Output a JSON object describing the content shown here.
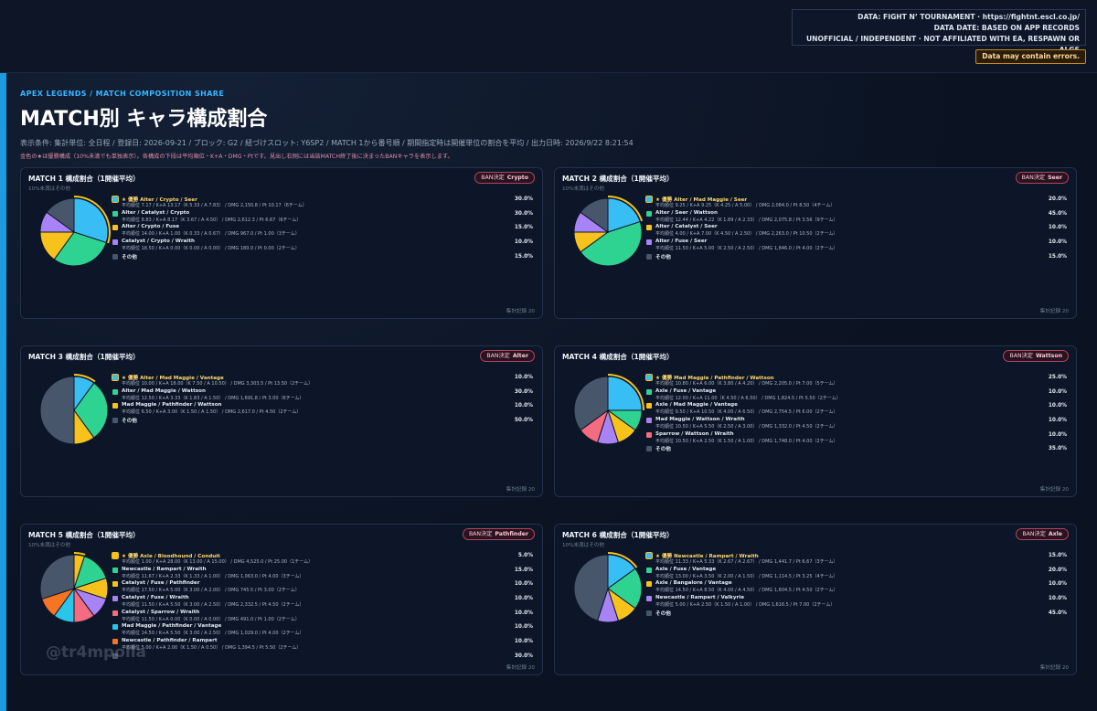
{
  "source": {
    "line1": "DATA: FIGHT N’ TOURNAMENT · https://fightnt.escl.co.jp/",
    "line2": "DATA DATE: BASED ON APP RECORDS",
    "line3": "UNOFFICIAL / INDEPENDENT · NOT AFFILIATED WITH EA, RESPAWN OR ALGS",
    "warning": "Data may contain errors."
  },
  "header": {
    "eyebrow": "APEX LEGENDS / MATCH COMPOSITION SHARE",
    "title": "MATCH別 キャラ構成割合",
    "conditions": "表示条件: 集計単位: 全日程 / 登録日: 2026-09-21 / ブロック: G2 / 紐づけスロット: Y6SP2 / MATCH 1から番号順 / 期間指定時は開催単位の割合を平均 / 出力日時: 2026/9/22 8:21:54",
    "note": "金色の★は優勝構成（10%未満でも単独表示）。各構成の下段は平均順位・K+A・DMG・Ptです。見出し右側には当該MATCH終了後に決まったBANキャラを表示します。"
  },
  "colors": {
    "blue": "#39bdf5",
    "green": "#2fd391",
    "yellow": "#f7c21b",
    "purple": "#a883f6",
    "red": "#f56b7f",
    "cyan": "#29c5ea",
    "orange": "#f77422",
    "gray": "#48566b",
    "best_ring": "#f7c21b"
  },
  "watermark": "@tr4mpolla",
  "ban_label": "BAN決定",
  "chart_data": [
    {
      "type": "pie",
      "title": "MATCH 1 構成割合（1開催平均）",
      "subtitle": "10%未満はその他",
      "ban": "Crypto",
      "footer": "集計記録 20",
      "slices": [
        {
          "name": "★ 優勝  Alter / Crypto / Seer",
          "stats": "平均順位 7.17 / K+A 13.17（K 5.33 / A 7.83） / DMG 2,150.8 / Pt 10.17（6チーム）",
          "value": 30,
          "label": "30.0%",
          "color": "blue",
          "best": true
        },
        {
          "name": "Alter / Catalyst / Crypto",
          "stats": "平均順位 8.83 / K+A 8.17（K 3.67 / A 4.50） / DMG 2,612.3 / Pt 6.67（6チーム）",
          "value": 30,
          "label": "30.0%",
          "color": "green"
        },
        {
          "name": "Alter / Crypto / Fuse",
          "stats": "平均順位 14.00 / K+A 1.00（K 0.33 / A 0.67） / DMG 967.0 / Pt 1.00（3チーム）",
          "value": 15,
          "label": "15.0%",
          "color": "yellow"
        },
        {
          "name": "Catalyst / Crypto / Wraith",
          "stats": "平均順位 18.50 / K+A 0.00（K 0.00 / A 0.00） / DMG 180.0 / Pt 0.00（2チーム）",
          "value": 10,
          "label": "10.0%",
          "color": "purple"
        },
        {
          "name": "その他",
          "stats": "",
          "value": 15,
          "label": "15.0%",
          "color": "gray"
        }
      ]
    },
    {
      "type": "pie",
      "title": "MATCH 2 構成割合（1開催平均）",
      "subtitle": "10%未満はその他",
      "ban": "Seer",
      "footer": "集計記録 20",
      "slices": [
        {
          "name": "★ 優勝  Alter / Mad Maggie / Seer",
          "stats": "平均順位 9.25 / K+A 9.25（K 4.25 / A 5.00） / DMG 2,084.0 / Pt 8.50（4チーム）",
          "value": 20,
          "label": "20.0%",
          "color": "blue",
          "best": true
        },
        {
          "name": "Alter / Seer / Wattson",
          "stats": "平均順位 12.44 / K+A 4.22（K 1.89 / A 2.33） / DMG 2,075.8 / Pt 3.56（9チーム）",
          "value": 45,
          "label": "45.0%",
          "color": "green"
        },
        {
          "name": "Alter / Catalyst / Seer",
          "stats": "平均順位 4.00 / K+A 7.00（K 4.50 / A 2.50） / DMG 2,263.0 / Pt 10.50（2チーム）",
          "value": 10,
          "label": "10.0%",
          "color": "yellow"
        },
        {
          "name": "Alter / Fuse / Seer",
          "stats": "平均順位 11.50 / K+A 5.00（K 2.50 / A 2.50） / DMG 1,846.0 / Pt 4.00（2チーム）",
          "value": 10,
          "label": "10.0%",
          "color": "purple"
        },
        {
          "name": "その他",
          "stats": "",
          "value": 15,
          "label": "15.0%",
          "color": "gray"
        }
      ]
    },
    {
      "type": "pie",
      "title": "MATCH 3 構成割合（1開催平均）",
      "subtitle": "",
      "ban": "Alter",
      "footer": "集計記録 20",
      "slices": [
        {
          "name": "★ 優勝  Alter / Mad Maggie / Vantage",
          "stats": "平均順位 10.00 / K+A 18.00（K 7.50 / A 10.50） / DMG 3,303.5 / Pt 13.50（2チーム）",
          "value": 10,
          "label": "10.0%",
          "color": "blue",
          "best": true
        },
        {
          "name": "Alter / Mad Maggie / Wattson",
          "stats": "平均順位 12.50 / K+A 3.33（K 1.83 / A 1.50） / DMG 1,691.8 / Pt 3.00（6チーム）",
          "value": 30,
          "label": "30.0%",
          "color": "green"
        },
        {
          "name": "Mad Maggie / Pathfinder / Wattson",
          "stats": "平均順位 6.50 / K+A 3.00（K 1.50 / A 1.50） / DMG 2,617.0 / Pt 4.50（2チーム）",
          "value": 10,
          "label": "10.0%",
          "color": "yellow"
        },
        {
          "name": "その他",
          "stats": "",
          "value": 50,
          "label": "50.0%",
          "color": "gray"
        }
      ]
    },
    {
      "type": "pie",
      "title": "MATCH 4 構成割合（1開催平均）",
      "subtitle": "",
      "ban": "Wattson",
      "footer": "集計記録 20",
      "slices": [
        {
          "name": "★ 優勝  Mad Maggie / Pathfinder / Wattson",
          "stats": "平均順位 10.80 / K+A 6.00（K 3.80 / A 4.20） / DMG 2,205.0 / Pt 7.00（5チーム）",
          "value": 25,
          "label": "25.0%",
          "color": "blue",
          "best": true
        },
        {
          "name": "Axle / Fuse / Vantage",
          "stats": "平均順位 12.00 / K+A 11.00（K 4.50 / A 6.50） / DMG 1,824.5 / Pt 5.50（2チーム）",
          "value": 10,
          "label": "10.0%",
          "color": "green"
        },
        {
          "name": "Axle / Mad Maggie / Vantage",
          "stats": "平均順位 9.50 / K+A 10.50（K 4.00 / A 6.50） / DMG 2,754.5 / Pt 6.00（2チーム）",
          "value": 10,
          "label": "10.0%",
          "color": "yellow"
        },
        {
          "name": "Mad Maggie / Wattson / Wraith",
          "stats": "平均順位 10.50 / K+A 5.50（K 2.50 / A 3.00） / DMG 1,332.0 / Pt 4.50（2チーム）",
          "value": 10,
          "label": "10.0%",
          "color": "purple"
        },
        {
          "name": "Sparrow / Wattson / Wraith",
          "stats": "平均順位 10.50 / K+A 2.50（K 1.50 / A 1.00） / DMG 1,748.0 / Pt 4.00（2チーム）",
          "value": 10,
          "label": "10.0%",
          "color": "red"
        },
        {
          "name": "その他",
          "stats": "",
          "value": 35,
          "label": "35.0%",
          "color": "gray"
        }
      ]
    },
    {
      "type": "pie",
      "title": "MATCH 5 構成割合（1開催平均）",
      "subtitle": "10%未満はその他",
      "ban": "Pathfinder",
      "footer": "集計記録 20",
      "slices": [
        {
          "name": "★ 優勝  Axle / Bloodhound / Conduit",
          "stats": "平均順位 1.00 / K+A 28.00（K 13.00 / A 15.00） / DMG 4,525.0 / Pt 25.00（1チーム）",
          "value": 5,
          "label": "5.0%",
          "color": "yellow",
          "best": true
        },
        {
          "name": "Newcastle / Rampart / Wraith",
          "stats": "平均順位 11.67 / K+A 2.33（K 1.33 / A 1.00） / DMG 1,063.0 / Pt 4.00（3チーム）",
          "value": 15,
          "label": "15.0%",
          "color": "green"
        },
        {
          "name": "Catalyst / Fuse / Pathfinder",
          "stats": "平均順位 17.50 / K+A 5.00（K 3.00 / A 2.00） / DMG 745.5 / Pt 3.00（2チーム）",
          "value": 10,
          "label": "10.0%",
          "color": "yellow"
        },
        {
          "name": "Catalyst / Fuse / Wraith",
          "stats": "平均順位 11.50 / K+A 5.50（K 3.00 / A 2.50） / DMG 2,332.5 / Pt 4.50（2チーム）",
          "value": 10,
          "label": "10.0%",
          "color": "purple"
        },
        {
          "name": "Catalyst / Sparrow / Wraith",
          "stats": "平均順位 11.50 / K+A 0.00（K 0.00 / A 0.00） / DMG 491.0 / Pt 1.00（2チーム）",
          "value": 10,
          "label": "10.0%",
          "color": "red"
        },
        {
          "name": "Mad Maggie / Pathfinder / Vantage",
          "stats": "平均順位 14.50 / K+A 5.50（K 3.00 / A 2.50） / DMG 1,029.0 / Pt 4.00（2チーム）",
          "value": 10,
          "label": "10.0%",
          "color": "cyan"
        },
        {
          "name": "Newcastle / Pathfinder / Rampart",
          "stats": "平均順位 5.00 / K+A 2.00（K 1.50 / A 0.50） / DMG 1,394.5 / Pt 5.50（2チーム）",
          "value": 10,
          "label": "10.0%",
          "color": "orange"
        },
        {
          "name": "",
          "stats": "",
          "value": 30,
          "label": "30.0%",
          "color": "gray"
        }
      ]
    },
    {
      "type": "pie",
      "title": "MATCH 6 構成割合（1開催平均）",
      "subtitle": "10%未満はその他",
      "ban": "Axle",
      "footer": "集計記録 20",
      "slices": [
        {
          "name": "★ 優勝  Newcastle / Rampart / Wraith",
          "stats": "平均順位 11.33 / K+A 5.33（K 2.67 / A 2.67） / DMG 1,441.7 / Pt 6.67（3チーム）",
          "value": 15,
          "label": "15.0%",
          "color": "blue",
          "best": true
        },
        {
          "name": "Axle / Fuse / Vantage",
          "stats": "平均順位 13.00 / K+A 3.50（K 2.00 / A 1.50） / DMG 1,114.5 / Pt 3.25（4チーム）",
          "value": 20,
          "label": "20.0%",
          "color": "green"
        },
        {
          "name": "Axle / Bangalore / Vantage",
          "stats": "平均順位 14.50 / K+A 8.50（K 4.00 / A 4.50） / DMG 1,604.5 / Pt 4.50（2チーム）",
          "value": 10,
          "label": "10.0%",
          "color": "yellow"
        },
        {
          "name": "Newcastle / Rampart / Valkyrie",
          "stats": "平均順位 5.00 / K+A 2.50（K 1.50 / A 1.00） / DMG 1,616.5 / Pt 7.00（2チーム）",
          "value": 10,
          "label": "10.0%",
          "color": "purple"
        },
        {
          "name": "その他",
          "stats": "",
          "value": 45,
          "label": "45.0%",
          "color": "gray"
        }
      ]
    }
  ]
}
